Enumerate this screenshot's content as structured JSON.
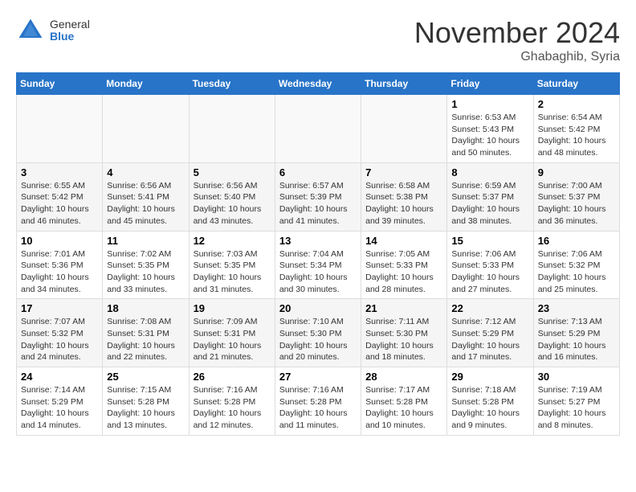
{
  "header": {
    "logo_general": "General",
    "logo_blue": "Blue",
    "month": "November 2024",
    "location": "Ghabaghib, Syria"
  },
  "weekdays": [
    "Sunday",
    "Monday",
    "Tuesday",
    "Wednesday",
    "Thursday",
    "Friday",
    "Saturday"
  ],
  "weeks": [
    [
      {
        "day": "",
        "info": ""
      },
      {
        "day": "",
        "info": ""
      },
      {
        "day": "",
        "info": ""
      },
      {
        "day": "",
        "info": ""
      },
      {
        "day": "",
        "info": ""
      },
      {
        "day": "1",
        "info": "Sunrise: 6:53 AM\nSunset: 5:43 PM\nDaylight: 10 hours\nand 50 minutes."
      },
      {
        "day": "2",
        "info": "Sunrise: 6:54 AM\nSunset: 5:42 PM\nDaylight: 10 hours\nand 48 minutes."
      }
    ],
    [
      {
        "day": "3",
        "info": "Sunrise: 6:55 AM\nSunset: 5:42 PM\nDaylight: 10 hours\nand 46 minutes."
      },
      {
        "day": "4",
        "info": "Sunrise: 6:56 AM\nSunset: 5:41 PM\nDaylight: 10 hours\nand 45 minutes."
      },
      {
        "day": "5",
        "info": "Sunrise: 6:56 AM\nSunset: 5:40 PM\nDaylight: 10 hours\nand 43 minutes."
      },
      {
        "day": "6",
        "info": "Sunrise: 6:57 AM\nSunset: 5:39 PM\nDaylight: 10 hours\nand 41 minutes."
      },
      {
        "day": "7",
        "info": "Sunrise: 6:58 AM\nSunset: 5:38 PM\nDaylight: 10 hours\nand 39 minutes."
      },
      {
        "day": "8",
        "info": "Sunrise: 6:59 AM\nSunset: 5:37 PM\nDaylight: 10 hours\nand 38 minutes."
      },
      {
        "day": "9",
        "info": "Sunrise: 7:00 AM\nSunset: 5:37 PM\nDaylight: 10 hours\nand 36 minutes."
      }
    ],
    [
      {
        "day": "10",
        "info": "Sunrise: 7:01 AM\nSunset: 5:36 PM\nDaylight: 10 hours\nand 34 minutes."
      },
      {
        "day": "11",
        "info": "Sunrise: 7:02 AM\nSunset: 5:35 PM\nDaylight: 10 hours\nand 33 minutes."
      },
      {
        "day": "12",
        "info": "Sunrise: 7:03 AM\nSunset: 5:35 PM\nDaylight: 10 hours\nand 31 minutes."
      },
      {
        "day": "13",
        "info": "Sunrise: 7:04 AM\nSunset: 5:34 PM\nDaylight: 10 hours\nand 30 minutes."
      },
      {
        "day": "14",
        "info": "Sunrise: 7:05 AM\nSunset: 5:33 PM\nDaylight: 10 hours\nand 28 minutes."
      },
      {
        "day": "15",
        "info": "Sunrise: 7:06 AM\nSunset: 5:33 PM\nDaylight: 10 hours\nand 27 minutes."
      },
      {
        "day": "16",
        "info": "Sunrise: 7:06 AM\nSunset: 5:32 PM\nDaylight: 10 hours\nand 25 minutes."
      }
    ],
    [
      {
        "day": "17",
        "info": "Sunrise: 7:07 AM\nSunset: 5:32 PM\nDaylight: 10 hours\nand 24 minutes."
      },
      {
        "day": "18",
        "info": "Sunrise: 7:08 AM\nSunset: 5:31 PM\nDaylight: 10 hours\nand 22 minutes."
      },
      {
        "day": "19",
        "info": "Sunrise: 7:09 AM\nSunset: 5:31 PM\nDaylight: 10 hours\nand 21 minutes."
      },
      {
        "day": "20",
        "info": "Sunrise: 7:10 AM\nSunset: 5:30 PM\nDaylight: 10 hours\nand 20 minutes."
      },
      {
        "day": "21",
        "info": "Sunrise: 7:11 AM\nSunset: 5:30 PM\nDaylight: 10 hours\nand 18 minutes."
      },
      {
        "day": "22",
        "info": "Sunrise: 7:12 AM\nSunset: 5:29 PM\nDaylight: 10 hours\nand 17 minutes."
      },
      {
        "day": "23",
        "info": "Sunrise: 7:13 AM\nSunset: 5:29 PM\nDaylight: 10 hours\nand 16 minutes."
      }
    ],
    [
      {
        "day": "24",
        "info": "Sunrise: 7:14 AM\nSunset: 5:29 PM\nDaylight: 10 hours\nand 14 minutes."
      },
      {
        "day": "25",
        "info": "Sunrise: 7:15 AM\nSunset: 5:28 PM\nDaylight: 10 hours\nand 13 minutes."
      },
      {
        "day": "26",
        "info": "Sunrise: 7:16 AM\nSunset: 5:28 PM\nDaylight: 10 hours\nand 12 minutes."
      },
      {
        "day": "27",
        "info": "Sunrise: 7:16 AM\nSunset: 5:28 PM\nDaylight: 10 hours\nand 11 minutes."
      },
      {
        "day": "28",
        "info": "Sunrise: 7:17 AM\nSunset: 5:28 PM\nDaylight: 10 hours\nand 10 minutes."
      },
      {
        "day": "29",
        "info": "Sunrise: 7:18 AM\nSunset: 5:28 PM\nDaylight: 10 hours\nand 9 minutes."
      },
      {
        "day": "30",
        "info": "Sunrise: 7:19 AM\nSunset: 5:27 PM\nDaylight: 10 hours\nand 8 minutes."
      }
    ]
  ]
}
